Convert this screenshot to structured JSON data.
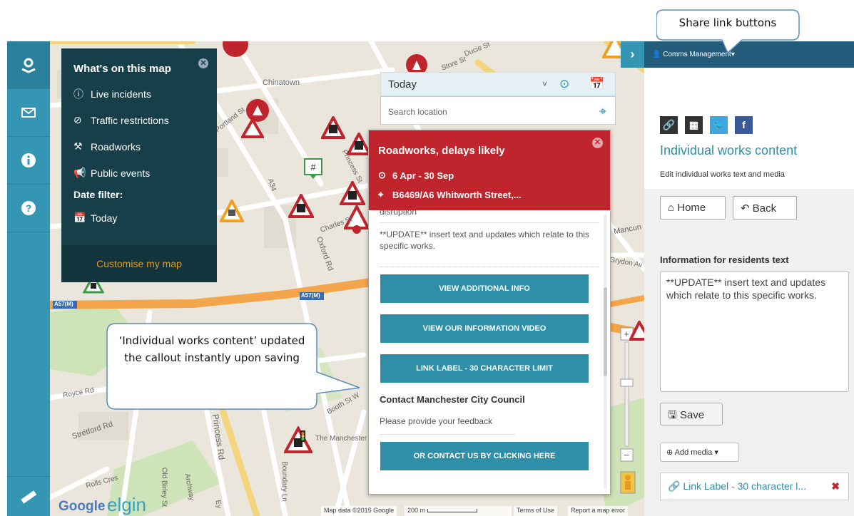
{
  "legend": {
    "title": "What's on this map",
    "items": [
      "Live incidents",
      "Traffic restrictions",
      "Roadworks",
      "Public events"
    ],
    "date_filter_label": "Date filter:",
    "date_filter_value": "Today",
    "customise": "Customise my map"
  },
  "datebar": {
    "value": "Today"
  },
  "search": {
    "placeholder": "Search location"
  },
  "popup": {
    "title": "Roadworks, delays likely",
    "dates": "6 Apr - 30 Sep",
    "location": "B6469/A6 Whitworth Street,...",
    "cut_text": "disruption",
    "update": "**UPDATE** insert text and updates which relate to this specific works.",
    "buttons": [
      "VIEW ADDITIONAL INFO",
      "VIEW OUR INFORMATION VIDEO",
      "LINK LABEL - 30 CHARACTER LIMIT"
    ],
    "contact": "Contact Manchester City Council",
    "feedback": "Please provide your feedback",
    "contact_button": "OR CONTACT US BY CLICKING HERE"
  },
  "map": {
    "labels": [
      "Chinatown",
      "Portland St",
      "Princess St",
      "Charles St",
      "Oxford Rd",
      "Royce Rd",
      "Stretford Rd",
      "Princess Rd",
      "Rolls Cres",
      "Boundary Ln",
      "Booth St W",
      "The Manchester M",
      "Mancun",
      "Grydon Av",
      "A57(M)",
      "A57(M)",
      "A34",
      "Store St",
      "Ducie St",
      "Archway",
      "Old Birley St",
      "Ey"
    ],
    "footer_data": "Map data ©2015 Google",
    "footer_scale": "200 m",
    "footer_terms": "Terms of Use",
    "footer_report": "Report a map error",
    "google": "Google",
    "elgin": "elgin"
  },
  "sidebar": {
    "header": "Comms Management",
    "title": "Individual works content",
    "subtitle": "Edit individual works text and media",
    "home": "Home",
    "back": "Back",
    "info_label": "Information for residents text",
    "info_text": "**UPDATE** insert text and updates which relate to this specific works.",
    "save": "Save",
    "add_media": "Add media",
    "link_item": "Link Label - 30 character l..."
  },
  "annotations": {
    "share": "Share link buttons",
    "callout": "‘Individual works content’ updated the callout instantly upon saving"
  },
  "colors": {
    "nav": "#3496b3",
    "roadworks_red": "#c0252d",
    "button_teal": "#2f8ea8",
    "legend_bg": "#173f4a",
    "customise": "#e39a1e"
  }
}
